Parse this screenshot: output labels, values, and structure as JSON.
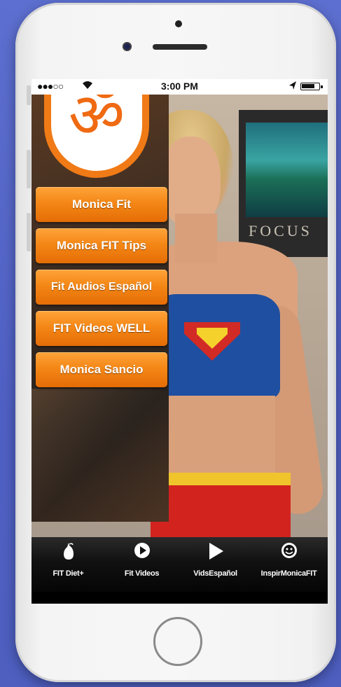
{
  "status_bar": {
    "signal": "●●●○○",
    "wifi_icon": "wifi-icon",
    "time": "3:00 PM",
    "location_icon": "location-arrow-icon",
    "battery_icon": "battery-icon"
  },
  "background": {
    "poster_text": "FOCUS"
  },
  "sidebar": {
    "logo_glyph": "ॐ",
    "items": [
      {
        "label": "Monica Fit"
      },
      {
        "label": "Monica FIT Tips"
      },
      {
        "label": "Fit Audios Español"
      },
      {
        "label": "FIT Videos WELL"
      },
      {
        "label": "Monica Sancio"
      }
    ]
  },
  "tabbar": {
    "tabs": [
      {
        "label": "FIT Diet+",
        "icon": "pear-icon"
      },
      {
        "label": "Fit Videos",
        "icon": "play-circle-icon"
      },
      {
        "label": "VidsEspañol",
        "icon": "play-icon"
      },
      {
        "label": "InspirMonicaFIT",
        "icon": "smiley-icon"
      }
    ]
  },
  "colors": {
    "accent_orange": "#f48716",
    "tabbar_bg": "#111111",
    "page_bg": "#5566c8"
  }
}
